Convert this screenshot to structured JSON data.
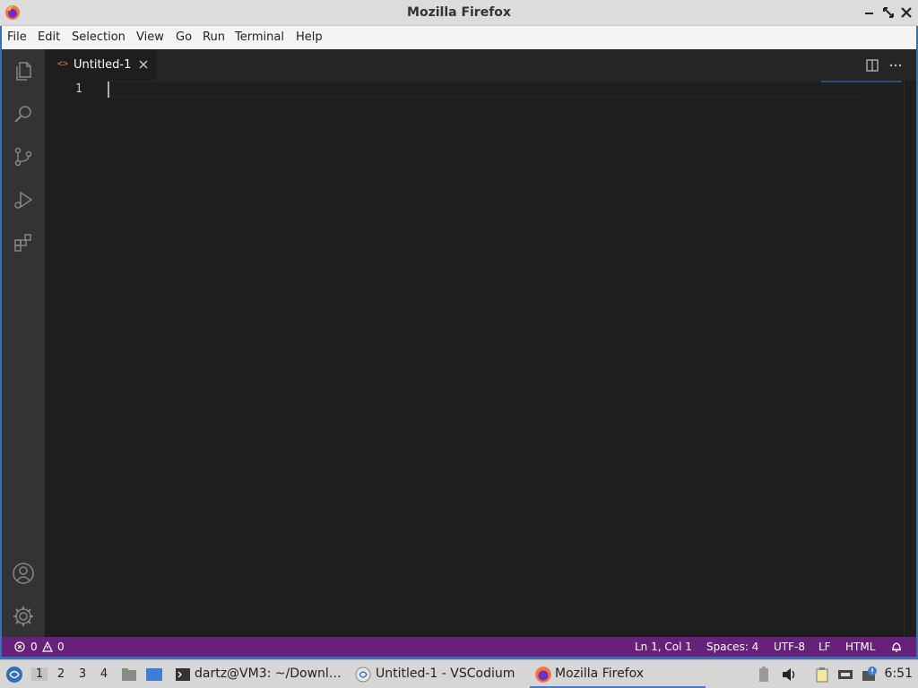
{
  "window": {
    "title": "Mozilla Firefox"
  },
  "menu": [
    "File",
    "Edit",
    "Selection",
    "View",
    "Go",
    "Run",
    "Terminal",
    "Help"
  ],
  "activity_bar": {
    "top": [
      "files-icon",
      "search-icon",
      "source-control-icon",
      "run-debug-icon",
      "extensions-icon"
    ],
    "bottom": [
      "account-icon",
      "gear-icon"
    ]
  },
  "editor": {
    "tab": {
      "icon_glyph": "<>",
      "label": "Untitled-1"
    },
    "line_number": "1"
  },
  "status": {
    "errors": "0",
    "warnings": "0",
    "position": "Ln 1, Col 1",
    "spaces": "Spaces: 4",
    "encoding": "UTF-8",
    "eol": "LF",
    "language": "HTML",
    "color": "#68217a"
  },
  "taskbar": {
    "workspaces": [
      "1",
      "2",
      "3",
      "4"
    ],
    "tasks": [
      {
        "label": "dartz@VM3: ~/Downl…"
      },
      {
        "label": "Untitled-1 - VSCodium"
      },
      {
        "label": "Mozilla Firefox"
      }
    ],
    "clock": "6:51"
  }
}
